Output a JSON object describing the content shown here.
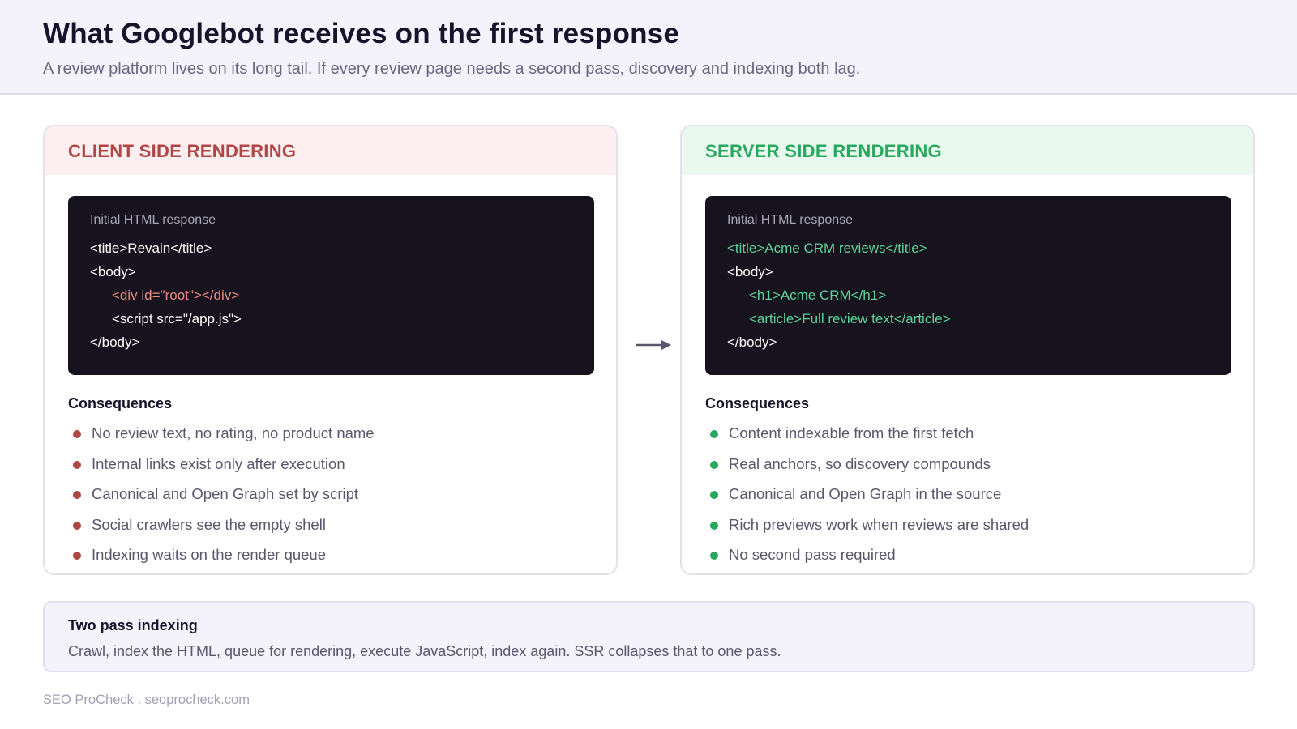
{
  "header": {
    "title": "What Googlebot receives on the first response",
    "subtitle": "A review platform lives on its long tail. If every review page needs a second pass, discovery and indexing both lag."
  },
  "csr": {
    "title": "CLIENT SIDE RENDERING",
    "code_label": "Initial HTML response",
    "code_lines": [
      "<title>Revain</title>",
      "<body>",
      "<div id=\"root\"></div>",
      "<script src=\"/app.js\">",
      "</body>"
    ],
    "consequences_title": "Consequences",
    "consequences": [
      "No review text, no rating, no product name",
      "Internal links exist only after execution",
      "Canonical and Open Graph set by script",
      "Social crawlers see the empty shell",
      "Indexing waits on the render queue"
    ]
  },
  "ssr": {
    "title": "SERVER SIDE RENDERING",
    "code_label": "Initial HTML response",
    "code_lines": [
      "<title>Acme CRM reviews</title>",
      "<body>",
      "<h1>Acme CRM</h1>",
      "<article>Full review text</article>",
      "</body>"
    ],
    "consequences_title": "Consequences",
    "consequences": [
      "Content indexable from the first fetch",
      "Real anchors, so discovery compounds",
      "Canonical and Open Graph in the source",
      "Rich previews work when reviews are shared",
      "No second pass required"
    ]
  },
  "note": {
    "title": "Two pass indexing",
    "text": "Crawl, index the HTML, queue for rendering, execute JavaScript, index again. SSR collapses that to one pass."
  },
  "footer": {
    "text": "SEO ProCheck . seoprocheck.com"
  },
  "colors": {
    "csr_accent": "#b04545",
    "ssr_accent": "#27a85e",
    "code_bg": "#16131f",
    "header_bg": "#f4f3fc"
  },
  "icons": {
    "flow_arrow": "arrow-right-icon"
  }
}
